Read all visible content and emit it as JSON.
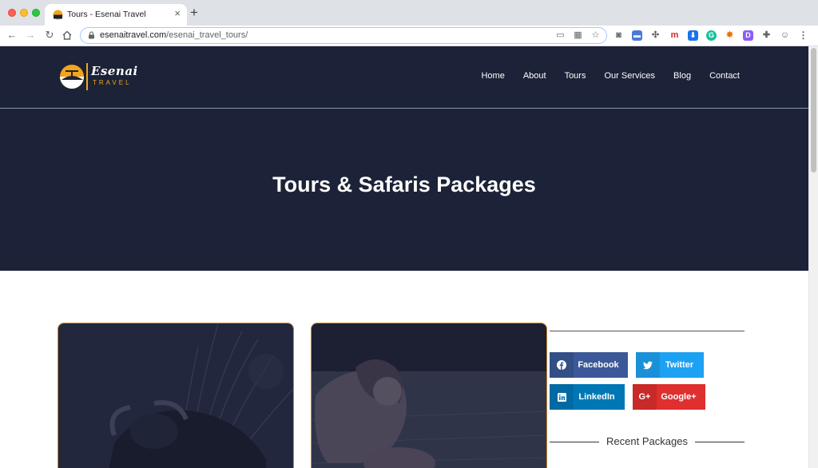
{
  "browser": {
    "tab_title": "Tours - Esenai Travel",
    "url_host": "esenaitravel.com",
    "url_path": "/esenai_travel_tours/"
  },
  "site": {
    "logo_text": "Esenai",
    "logo_sub": "TRAVEL",
    "nav": [
      "Home",
      "About",
      "Tours",
      "Our Services",
      "Blog",
      "Contact"
    ]
  },
  "hero": {
    "title": "Tours & Safaris Packages"
  },
  "sidebar": {
    "share": {
      "facebook": "Facebook",
      "twitter": "Twitter",
      "linkedin": "LinkedIn",
      "google": "Google+"
    },
    "recent_heading": "Recent Packages"
  },
  "colors": {
    "header_bg": "#1c2237",
    "accent": "#f2a51a",
    "card_border": "#c9862a"
  }
}
